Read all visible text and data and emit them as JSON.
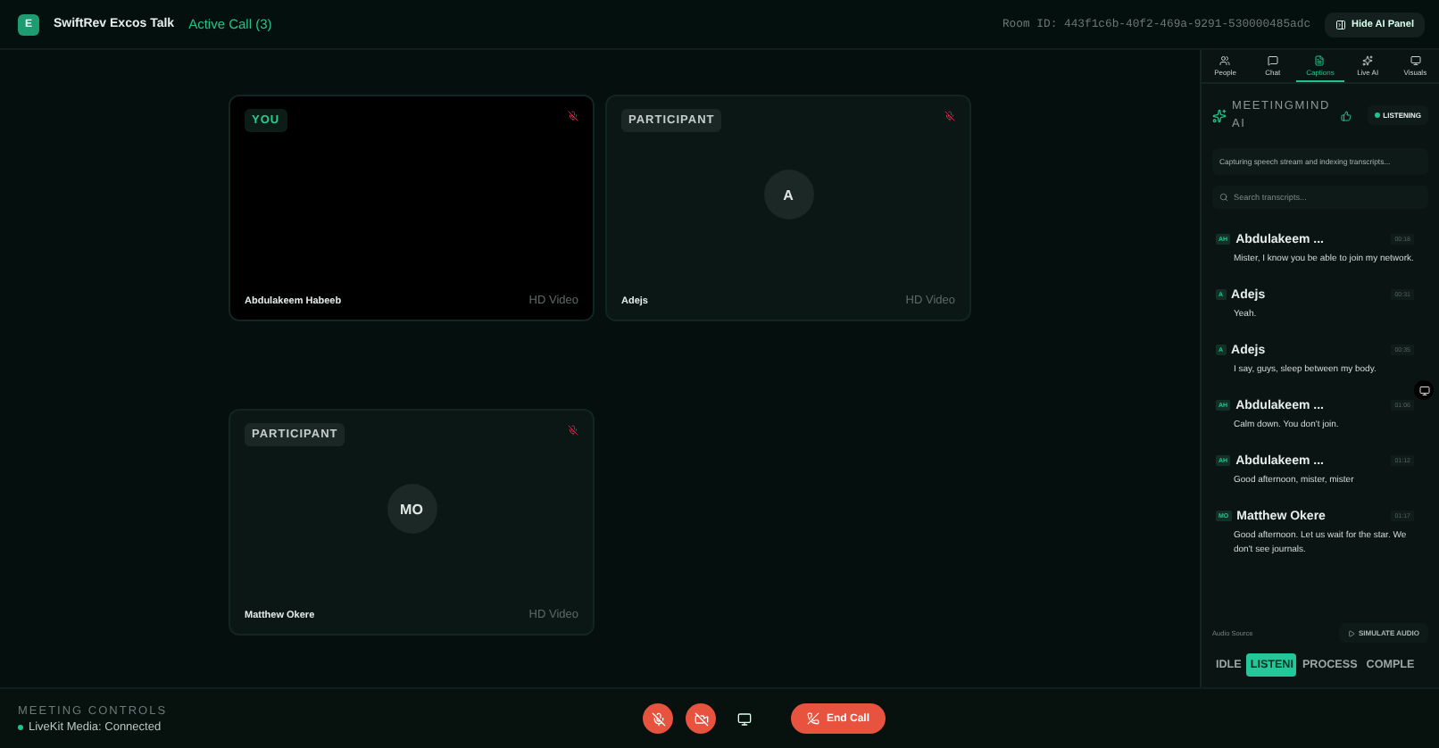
{
  "header": {
    "logo": "E",
    "title": "SwiftRev Excos Talk",
    "call_status": "Active Call (3)",
    "room_id": "Room ID: 443f1c6b-40f2-469a-9291-530000485adc",
    "hide_button": "Hide AI Panel"
  },
  "tiles": [
    {
      "badge": "YOU",
      "kind": "self",
      "muted": true,
      "name": "Abdulakeem Habeeb",
      "quality": "HD Video"
    },
    {
      "badge": "PARTICIPANT",
      "kind": "avatar",
      "initials": "A",
      "muted": true,
      "name": "Adejs",
      "quality": "HD Video"
    },
    {
      "badge": "PARTICIPANT",
      "kind": "avatar",
      "initials": "MO",
      "muted": true,
      "name": "Matthew Okere",
      "quality": "HD Video"
    }
  ],
  "panel": {
    "tabs": [
      {
        "label": "People",
        "selected": false
      },
      {
        "label": "Chat",
        "selected": false
      },
      {
        "label": "Captions",
        "selected": true
      },
      {
        "label": "Live AI",
        "selected": false
      },
      {
        "label": "Visuals",
        "selected": false
      }
    ],
    "title": "MEETINGMIND AI",
    "status": "LISTENING",
    "info": "Capturing speech stream and indexing transcripts...",
    "search_placeholder": "Search transcripts...",
    "transcripts": [
      {
        "initials": "AH",
        "speaker": "Abdulakeem ...",
        "time": "00:18",
        "text": "Mister, I know you be able to join my network."
      },
      {
        "initials": "A",
        "speaker": "Adejs",
        "time": "00:31",
        "text": "Yeah."
      },
      {
        "initials": "A",
        "speaker": "Adejs",
        "time": "00:35",
        "text": "I say, guys, sleep between my body."
      },
      {
        "initials": "AH",
        "speaker": "Abdulakeem ...",
        "time": "01:06",
        "text": "Calm down. You don't join."
      },
      {
        "initials": "AH",
        "speaker": "Abdulakeem ...",
        "time": "01:12",
        "text": "Good afternoon, mister, mister"
      },
      {
        "initials": "MO",
        "speaker": "Matthew Okere",
        "time": "01:17",
        "text": "Good afternoon. Let us wait for the star. We don't see journals."
      }
    ],
    "audio_source": "Audio Source",
    "simulate_button": "SIMULATE AUDIO",
    "stages": [
      {
        "label": "IDLE",
        "selected": false
      },
      {
        "label": "LISTENI",
        "selected": true
      },
      {
        "label": "PROCESS",
        "selected": false
      },
      {
        "label": "COMPLE",
        "selected": false
      }
    ]
  },
  "footer": {
    "title": "MEETING CONTROLS",
    "status": "LiveKit Media: Connected",
    "mic_muted": true,
    "camera_off": true,
    "end_button": "End Call"
  }
}
